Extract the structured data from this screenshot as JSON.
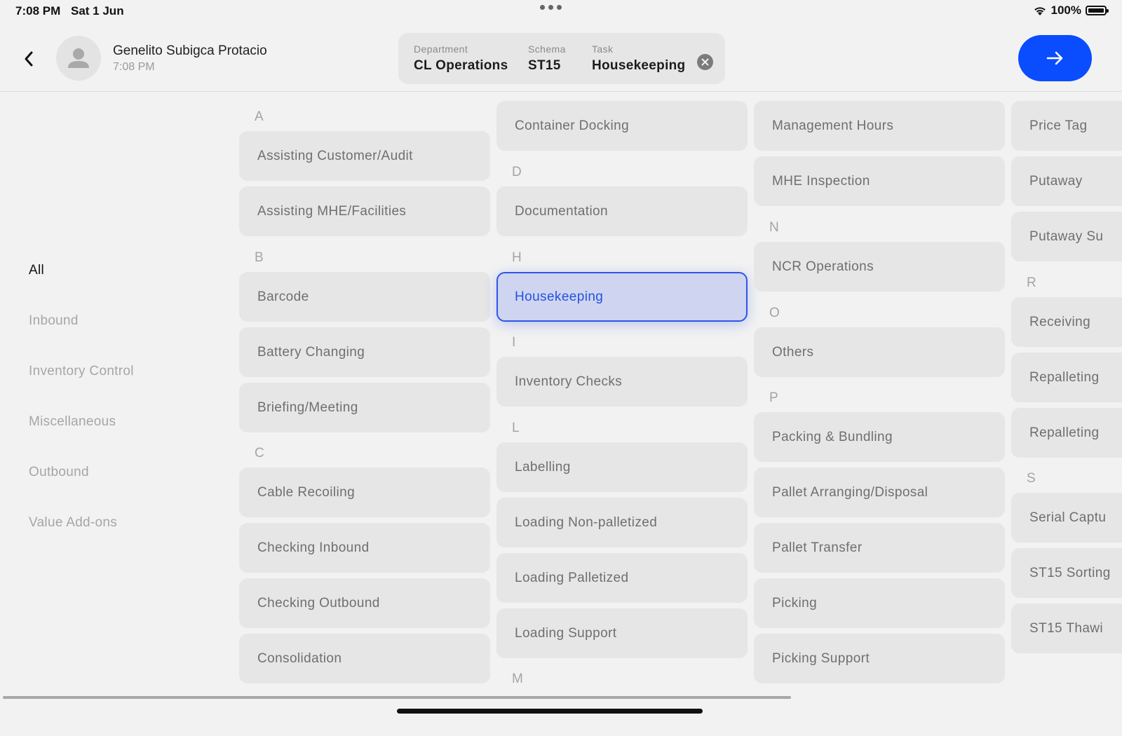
{
  "status_bar": {
    "time": "7:08 PM",
    "date": "Sat 1 Jun",
    "battery": "100%",
    "icons": [
      "wifi-icon",
      "battery-icon"
    ]
  },
  "header": {
    "user_name": "Genelito Subigca Protacio",
    "user_time": "7:08 PM",
    "department_label": "Department",
    "department_value": "CL Operations",
    "schema_label": "Schema",
    "schema_value": "ST15",
    "task_label": "Task",
    "task_value": "Housekeeping",
    "icons": [
      "chevron-left-icon",
      "avatar-icon",
      "clear-icon",
      "arrow-right-icon"
    ]
  },
  "colors": {
    "accent": "#0a4dff",
    "selected_bg": "#cfd5f0",
    "selected_border": "#2d55e8",
    "tile_bg": "#e6e6e6",
    "background": "#f2f2f2"
  },
  "categories": [
    "All",
    "Inbound",
    "Inventory Control",
    "Miscellaneous",
    "Outbound",
    "Value Add-ons"
  ],
  "active_category": "All",
  "sections": {
    "A": "A",
    "B": "B",
    "C": "C",
    "D": "D",
    "H": "H",
    "I": "I",
    "L": "L",
    "M": "M",
    "N": "N",
    "O": "O",
    "P": "P",
    "R": "R",
    "S": "S"
  },
  "tasks": {
    "assisting_customer_audit": "Assisting Customer/Audit",
    "assisting_mhe_facilities": "Assisting MHE/Facilities",
    "barcode": "Barcode",
    "battery_changing": "Battery Changing",
    "briefing_meeting": "Briefing/Meeting",
    "cable_recoiling": "Cable Recoiling",
    "checking_inbound": "Checking Inbound",
    "checking_outbound": "Checking Outbound",
    "consolidation": "Consolidation",
    "container_docking": "Container Docking",
    "documentation": "Documentation",
    "housekeeping": "Housekeeping",
    "inventory_checks": "Inventory Checks",
    "labelling": "Labelling",
    "loading_non_palletized": "Loading Non-palletized",
    "loading_palletized": "Loading Palletized",
    "loading_support": "Loading Support",
    "management_hours": "Management Hours",
    "mhe_inspection": "MHE Inspection",
    "ncr_operations": "NCR Operations",
    "others": "Others",
    "packing_bundling": "Packing & Bundling",
    "pallet_arranging_disposal": "Pallet Arranging/Disposal",
    "pallet_transfer": "Pallet Transfer",
    "picking": "Picking",
    "picking_support": "Picking Support",
    "price_tag": "Price Tag",
    "putaway": "Putaway",
    "putaway_su": "Putaway Su",
    "receiving": "Receiving",
    "repalleting_1": "Repalleting",
    "repalleting_2": "Repalleting",
    "serial_captu": "Serial Captu",
    "st15_sortin": "ST15 Sorting",
    "st15_thawi": "ST15 Thawi"
  },
  "selected_task": "Housekeeping"
}
